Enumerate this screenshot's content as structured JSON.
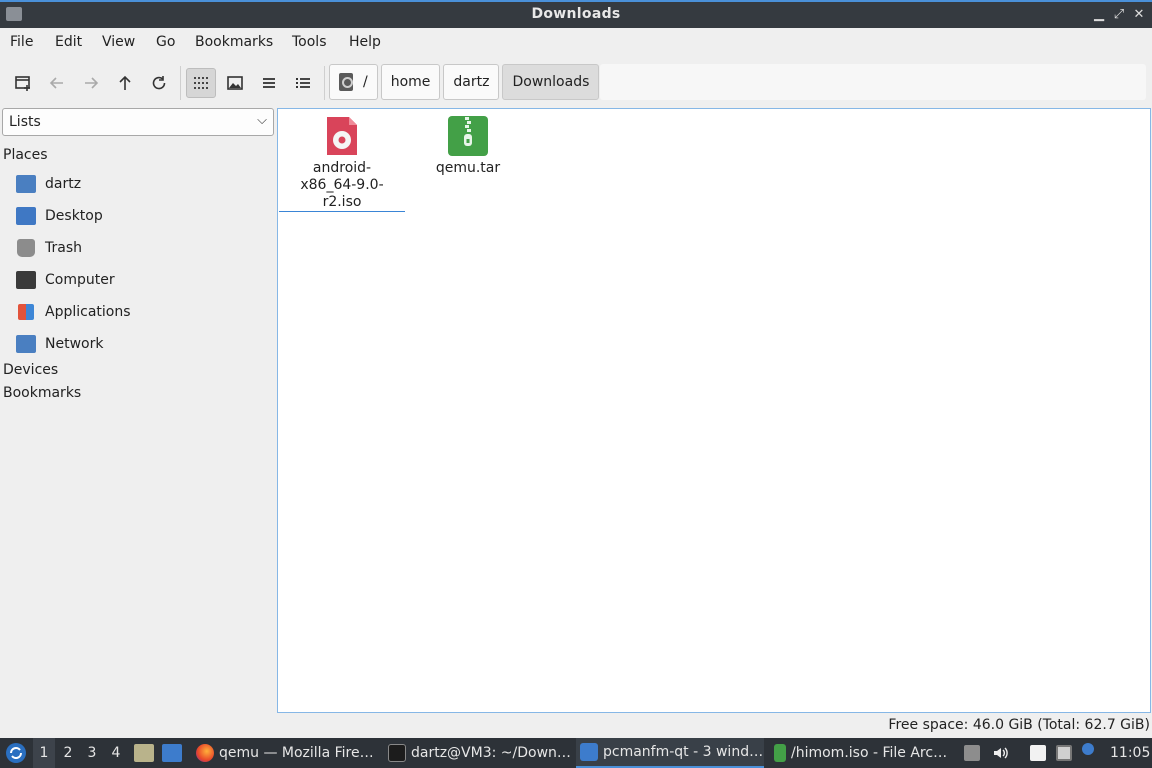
{
  "window": {
    "title": "Downloads"
  },
  "menu": [
    "File",
    "Edit",
    "View",
    "Go",
    "Bookmarks",
    "Tools",
    "Help"
  ],
  "path": {
    "segments": [
      "/",
      "home",
      "dartz",
      "Downloads"
    ]
  },
  "sidebar": {
    "selector": "Lists",
    "places_label": "Places",
    "places": [
      "dartz",
      "Desktop",
      "Trash",
      "Computer",
      "Applications",
      "Network"
    ],
    "devices_label": "Devices",
    "bookmarks_label": "Bookmarks"
  },
  "files": [
    {
      "name_line1": "android-",
      "name_line2": "x86_64-9.0-r2.iso"
    },
    {
      "name_line1": "qemu.tar"
    }
  ],
  "status": {
    "text": "Free space: 46.0 GiB (Total: 62.7 GiB)"
  },
  "taskbar": {
    "workspaces": [
      "1",
      "2",
      "3",
      "4"
    ],
    "tasks": [
      "qemu — Mozilla Fire…",
      "dartz@VM3: ~/Down…",
      "pcmanfm-qt - 3 wind…",
      "/himom.iso - File Arc…"
    ],
    "clock": "11:05"
  },
  "colors": {
    "accent": "#4a90d9",
    "iso_icon": "#d9445a",
    "archive_icon": "#43a047",
    "taskbar": "#2d3238"
  }
}
